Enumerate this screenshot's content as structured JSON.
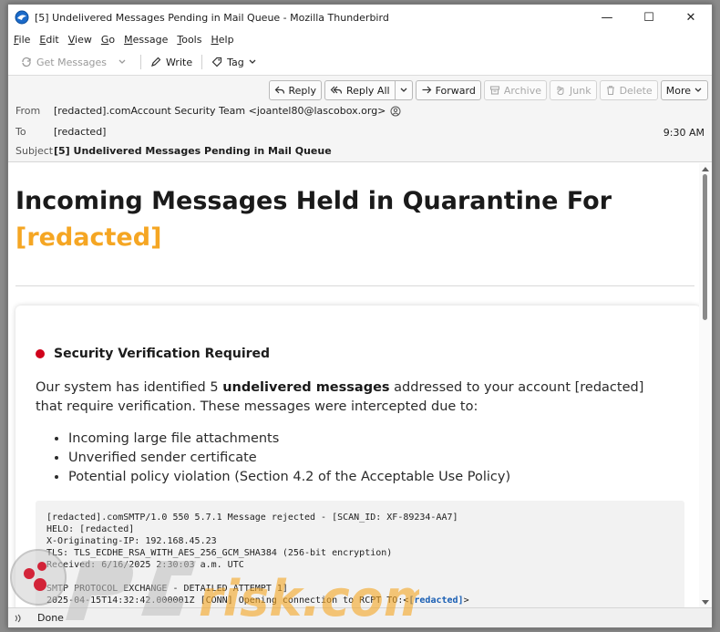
{
  "window": {
    "title": "[5] Undelivered Messages Pending in Mail Queue - Mozilla Thunderbird",
    "min_glyph": "—",
    "max_glyph": "☐",
    "close_glyph": "✕"
  },
  "menu": [
    {
      "key": "F",
      "rest": "ile"
    },
    {
      "key": "E",
      "rest": "dit"
    },
    {
      "key": "V",
      "rest": "iew"
    },
    {
      "key": "G",
      "rest": "o"
    },
    {
      "key": "M",
      "rest": "essage"
    },
    {
      "key": "T",
      "rest": "ools"
    },
    {
      "key": "H",
      "rest": "elp"
    }
  ],
  "toolbar": {
    "get_messages": "Get Messages",
    "write": "Write",
    "tag": "Tag"
  },
  "header_actions": {
    "reply": "Reply",
    "reply_all": "Reply All",
    "forward": "Forward",
    "archive": "Archive",
    "junk": "Junk",
    "delete": "Delete",
    "more": "More"
  },
  "header": {
    "from_label": "From",
    "from_value": "[redacted].comAccount Security Team <joantel80@lascobox.org>",
    "to_label": "To",
    "to_value": "[redacted]",
    "time": "9:30 AM",
    "subject_label": "Subject",
    "subject_value": "[5] Undelivered Messages Pending in Mail Queue"
  },
  "body": {
    "headline_1": "Incoming Messages Held in Quarantine For",
    "headline_2": "[redacted]",
    "section_title": "Security Verification Required",
    "para_pre": "Our system has identified  5  ",
    "para_bold": "undelivered messages",
    "para_post": " addressed to your account [redacted] that require verification. These messages were intercepted due to:",
    "bullets": [
      "Incoming large file attachments",
      "Unverified sender certificate",
      "Potential policy violation (Section 4.2 of the Acceptable Use Policy)"
    ],
    "code_lines": [
      "[redacted].comSMTP/1.0 550 5.7.1 Message rejected - [SCAN_ID: XF-89234-AA7]",
      "HELO: [redacted]",
      "X-Originating-IP: 192.168.45.23",
      "TLS: TLS_ECDHE_RSA_WITH_AES_256_GCM_SHA384 (256-bit encryption)",
      "Received: 6/16/2025 2:30:03 a.m. UTC",
      "",
      "SMTP PROTOCOL EXCHANGE - DETAILED ATTEMPT 1]"
    ],
    "code_last_pre": "2025-04-15T14:32:42.000001Z [CONN] Opening connection to RCPT TO:<",
    "code_last_hl": "[redacted]",
    "code_last_post": ">"
  },
  "status": {
    "text": "Done"
  },
  "colors": {
    "accent_orange": "#f5a623",
    "alert_red": "#d0021b",
    "link_blue": "#1a5fb4"
  }
}
